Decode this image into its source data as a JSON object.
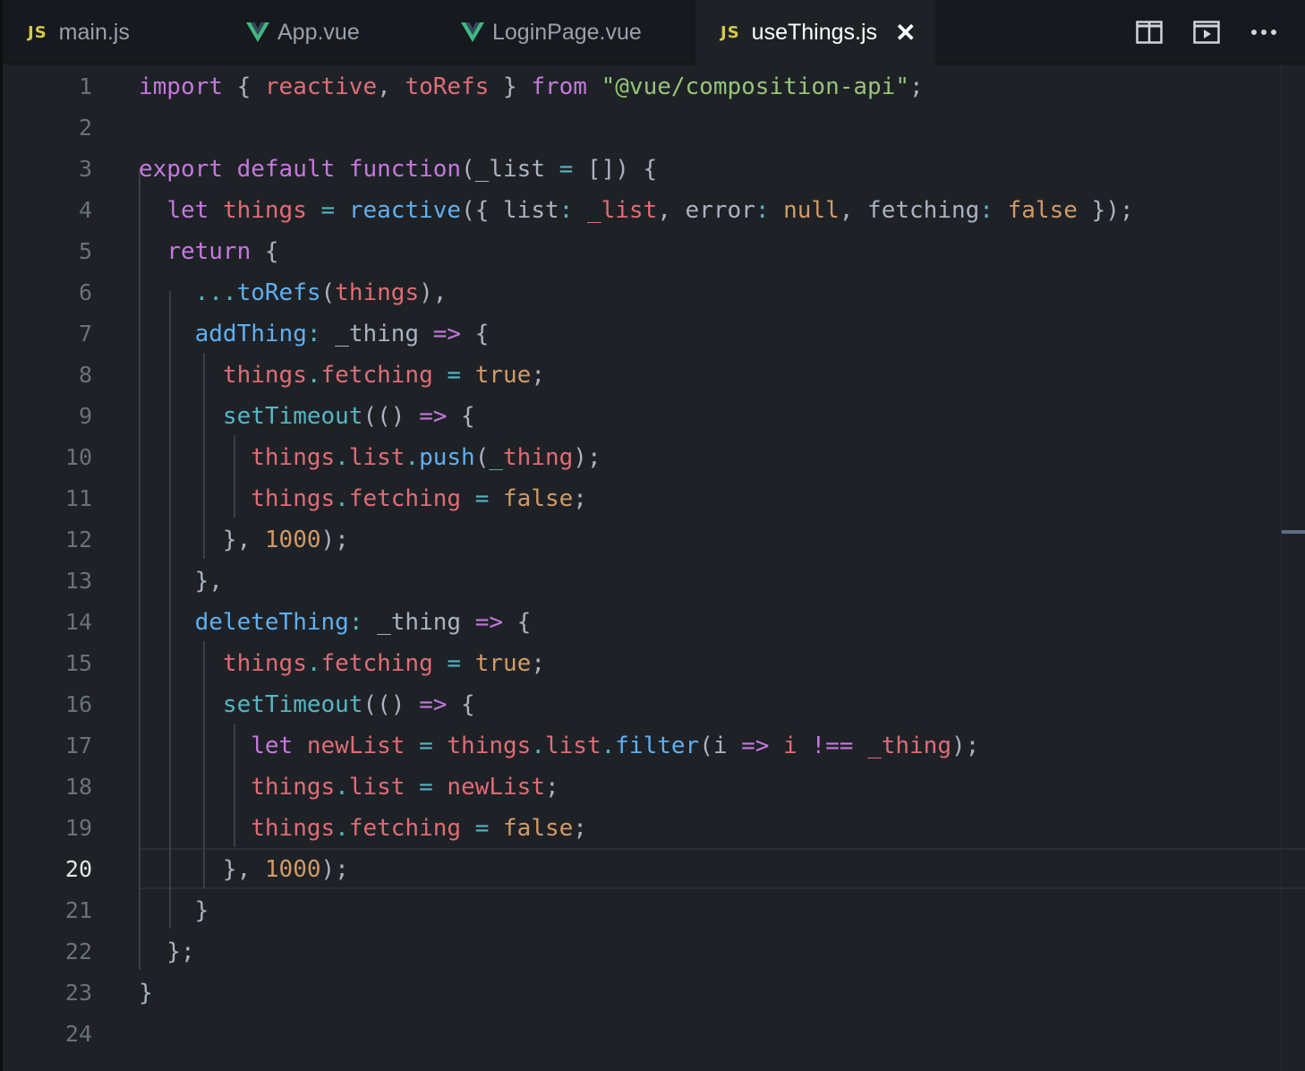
{
  "tabs": [
    {
      "label": "main.js",
      "icon": "js-icon",
      "active": false
    },
    {
      "label": "App.vue",
      "icon": "vue-icon",
      "active": false
    },
    {
      "label": "LoginPage.vue",
      "icon": "vue-icon",
      "active": false
    },
    {
      "label": "useThings.js",
      "icon": "js-icon",
      "active": true
    }
  ],
  "tab_icon_js_text": "JS",
  "tab_close_glyph": "✕",
  "toolbar": {
    "split_editor_icon": "split-editor-icon",
    "run_icon": "run-preview-icon",
    "more_icon": "more-actions-icon"
  },
  "editor": {
    "current_line": 20,
    "line_numbers": [
      "1",
      "2",
      "3",
      "4",
      "5",
      "6",
      "7",
      "8",
      "9",
      "10",
      "11",
      "12",
      "13",
      "14",
      "15",
      "16",
      "17",
      "18",
      "19",
      "20",
      "21",
      "22",
      "23",
      "24"
    ],
    "lines": [
      [
        [
          "k",
          "import"
        ],
        [
          "p",
          " { "
        ],
        [
          "v",
          "reactive"
        ],
        [
          "p",
          ", "
        ],
        [
          "v",
          "toRefs"
        ],
        [
          "p",
          " } "
        ],
        [
          "k",
          "from"
        ],
        [
          "p",
          " "
        ],
        [
          "s",
          "\"@vue/composition-api\""
        ],
        [
          "p",
          ";"
        ]
      ],
      [],
      [
        [
          "k",
          "export"
        ],
        [
          "p",
          " "
        ],
        [
          "k",
          "default"
        ],
        [
          "p",
          " "
        ],
        [
          "k",
          "function"
        ],
        [
          "p",
          "(_list "
        ],
        [
          "c",
          "="
        ],
        [
          "p",
          " []) {"
        ]
      ],
      [
        [
          "p",
          "  "
        ],
        [
          "k",
          "let"
        ],
        [
          "p",
          " "
        ],
        [
          "v",
          "things"
        ],
        [
          "p",
          " "
        ],
        [
          "c",
          "="
        ],
        [
          "p",
          " "
        ],
        [
          "f",
          "reactive"
        ],
        [
          "p",
          "({ list"
        ],
        [
          "c",
          ":"
        ],
        [
          "p",
          " "
        ],
        [
          "v",
          "_list"
        ],
        [
          "p",
          ", error"
        ],
        [
          "c",
          ":"
        ],
        [
          "p",
          " "
        ],
        [
          "n",
          "null"
        ],
        [
          "p",
          ", fetching"
        ],
        [
          "c",
          ":"
        ],
        [
          "p",
          " "
        ],
        [
          "n",
          "false"
        ],
        [
          "p",
          " });"
        ]
      ],
      [
        [
          "p",
          "  "
        ],
        [
          "k",
          "return"
        ],
        [
          "p",
          " {"
        ]
      ],
      [
        [
          "p",
          "    "
        ],
        [
          "c",
          "..."
        ],
        [
          "f",
          "toRefs"
        ],
        [
          "p",
          "("
        ],
        [
          "v",
          "things"
        ],
        [
          "p",
          "),"
        ]
      ],
      [
        [
          "p",
          "    "
        ],
        [
          "f",
          "addThing"
        ],
        [
          "c",
          ":"
        ],
        [
          "p",
          " _thing "
        ],
        [
          "k",
          "=>"
        ],
        [
          "p",
          " {"
        ]
      ],
      [
        [
          "p",
          "      "
        ],
        [
          "v",
          "things"
        ],
        [
          "c",
          "."
        ],
        [
          "v",
          "fetching"
        ],
        [
          "p",
          " "
        ],
        [
          "c",
          "="
        ],
        [
          "p",
          " "
        ],
        [
          "n",
          "true"
        ],
        [
          "p",
          ";"
        ]
      ],
      [
        [
          "p",
          "      "
        ],
        [
          "c",
          "setTimeout"
        ],
        [
          "p",
          "(() "
        ],
        [
          "k",
          "=>"
        ],
        [
          "p",
          " {"
        ]
      ],
      [
        [
          "p",
          "        "
        ],
        [
          "v",
          "things"
        ],
        [
          "c",
          "."
        ],
        [
          "v",
          "list"
        ],
        [
          "c",
          "."
        ],
        [
          "f",
          "push"
        ],
        [
          "p",
          "("
        ],
        [
          "v",
          "_thing"
        ],
        [
          "p",
          ");"
        ]
      ],
      [
        [
          "p",
          "        "
        ],
        [
          "v",
          "things"
        ],
        [
          "c",
          "."
        ],
        [
          "v",
          "fetching"
        ],
        [
          "p",
          " "
        ],
        [
          "c",
          "="
        ],
        [
          "p",
          " "
        ],
        [
          "n",
          "false"
        ],
        [
          "p",
          ";"
        ]
      ],
      [
        [
          "p",
          "      }, "
        ],
        [
          "n",
          "1000"
        ],
        [
          "p",
          ");"
        ]
      ],
      [
        [
          "p",
          "    },"
        ]
      ],
      [
        [
          "p",
          "    "
        ],
        [
          "f",
          "deleteThing"
        ],
        [
          "c",
          ":"
        ],
        [
          "p",
          " _thing "
        ],
        [
          "k",
          "=>"
        ],
        [
          "p",
          " {"
        ]
      ],
      [
        [
          "p",
          "      "
        ],
        [
          "v",
          "things"
        ],
        [
          "c",
          "."
        ],
        [
          "v",
          "fetching"
        ],
        [
          "p",
          " "
        ],
        [
          "c",
          "="
        ],
        [
          "p",
          " "
        ],
        [
          "n",
          "true"
        ],
        [
          "p",
          ";"
        ]
      ],
      [
        [
          "p",
          "      "
        ],
        [
          "c",
          "setTimeout"
        ],
        [
          "p",
          "(() "
        ],
        [
          "k",
          "=>"
        ],
        [
          "p",
          " {"
        ]
      ],
      [
        [
          "p",
          "        "
        ],
        [
          "k",
          "let"
        ],
        [
          "p",
          " "
        ],
        [
          "v",
          "newList"
        ],
        [
          "p",
          " "
        ],
        [
          "c",
          "="
        ],
        [
          "p",
          " "
        ],
        [
          "v",
          "things"
        ],
        [
          "c",
          "."
        ],
        [
          "v",
          "list"
        ],
        [
          "c",
          "."
        ],
        [
          "f",
          "filter"
        ],
        [
          "p",
          "(i "
        ],
        [
          "k",
          "=>"
        ],
        [
          "p",
          " "
        ],
        [
          "v",
          "i"
        ],
        [
          "p",
          " "
        ],
        [
          "k",
          "!=="
        ],
        [
          "p",
          " "
        ],
        [
          "v",
          "_thing"
        ],
        [
          "p",
          ");"
        ]
      ],
      [
        [
          "p",
          "        "
        ],
        [
          "v",
          "things"
        ],
        [
          "c",
          "."
        ],
        [
          "v",
          "list"
        ],
        [
          "p",
          " "
        ],
        [
          "c",
          "="
        ],
        [
          "p",
          " "
        ],
        [
          "v",
          "newList"
        ],
        [
          "p",
          ";"
        ]
      ],
      [
        [
          "p",
          "        "
        ],
        [
          "v",
          "things"
        ],
        [
          "c",
          "."
        ],
        [
          "v",
          "fetching"
        ],
        [
          "p",
          " "
        ],
        [
          "c",
          "="
        ],
        [
          "p",
          " "
        ],
        [
          "n",
          "false"
        ],
        [
          "p",
          ";"
        ]
      ],
      [
        [
          "p",
          "      }, "
        ],
        [
          "n",
          "1000"
        ],
        [
          "p",
          ");"
        ]
      ],
      [
        [
          "p",
          "    }"
        ]
      ],
      [
        [
          "p",
          "  };"
        ]
      ],
      [
        [
          "p",
          "}"
        ]
      ],
      []
    ]
  },
  "colors": {
    "background": "#1e2227",
    "tabbar": "#16191d",
    "keyword": "#c678dd",
    "variable": "#e06c75",
    "function": "#61afef",
    "string": "#98c379",
    "number": "#d19a66",
    "operator": "#56b6c2",
    "js_icon": "#d6c94b",
    "vue_icon": "#41b883"
  }
}
